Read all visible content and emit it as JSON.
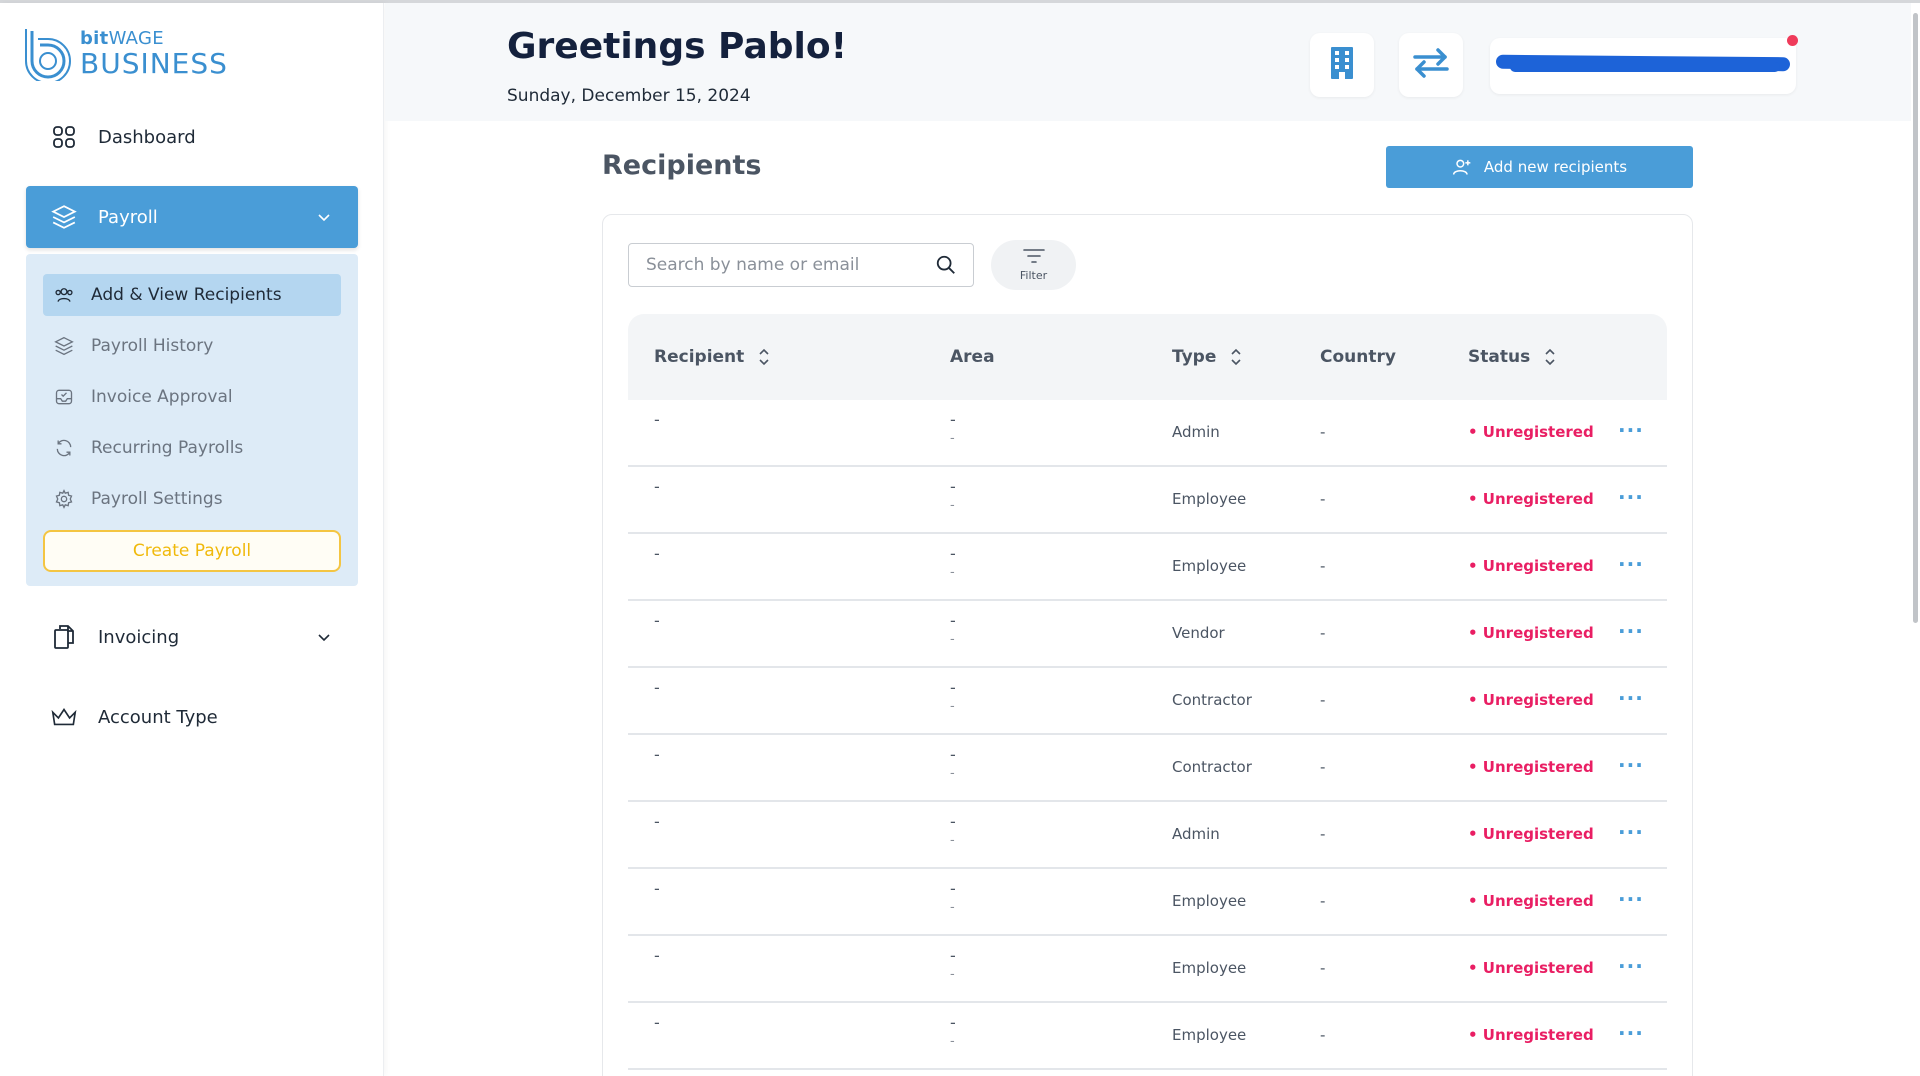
{
  "brand": {
    "small_prefix": "bit",
    "small_suffix": "WAGE",
    "big": "BUSINESS",
    "color": "#3a8fd0"
  },
  "sidebar": {
    "dashboard": "Dashboard",
    "payroll": "Payroll",
    "submenu": [
      {
        "label": "Add & View Recipients",
        "icon": "users-icon",
        "active": true
      },
      {
        "label": "Payroll History",
        "icon": "layers-icon"
      },
      {
        "label": "Invoice Approval",
        "icon": "inbox-check-icon"
      },
      {
        "label": "Recurring Payrolls",
        "icon": "refresh-icon"
      },
      {
        "label": "Payroll Settings",
        "icon": "gear-icon"
      }
    ],
    "create_payroll": "Create Payroll",
    "invoicing": "Invoicing",
    "account_type": "Account Type"
  },
  "header": {
    "greeting": "Greetings Pablo!",
    "date": "Sunday, December 15, 2024"
  },
  "page": {
    "title": "Recipients",
    "add_button": "Add new recipients",
    "search_placeholder": "Search by name or email",
    "filter_label": "Filter"
  },
  "table": {
    "columns": {
      "recipient": "Recipient",
      "area": "Area",
      "type": "Type",
      "country": "Country",
      "status": "Status"
    },
    "rows": [
      {
        "recipient": "-",
        "area": "-",
        "area_sub": "-",
        "type": "Admin",
        "country": "-",
        "status": "• Unregistered"
      },
      {
        "recipient": "-",
        "area": "-",
        "area_sub": "-",
        "type": "Employee",
        "country": "-",
        "status": "• Unregistered"
      },
      {
        "recipient": "-",
        "area": "-",
        "area_sub": "-",
        "type": "Employee",
        "country": "-",
        "status": "• Unregistered"
      },
      {
        "recipient": "-",
        "area": "-",
        "area_sub": "-",
        "type": "Vendor",
        "country": "-",
        "status": "• Unregistered"
      },
      {
        "recipient": "-",
        "area": "-",
        "area_sub": "-",
        "type": "Contractor",
        "country": "-",
        "status": "• Unregistered"
      },
      {
        "recipient": "-",
        "area": "-",
        "area_sub": "-",
        "type": "Contractor",
        "country": "-",
        "status": "• Unregistered"
      },
      {
        "recipient": "-",
        "area": "-",
        "area_sub": "-",
        "type": "Admin",
        "country": "-",
        "status": "• Unregistered"
      },
      {
        "recipient": "-",
        "area": "-",
        "area_sub": "-",
        "type": "Employee",
        "country": "-",
        "status": "• Unregistered"
      },
      {
        "recipient": "-",
        "area": "-",
        "area_sub": "-",
        "type": "Employee",
        "country": "-",
        "status": "• Unregistered"
      },
      {
        "recipient": "-",
        "area": "-",
        "area_sub": "-",
        "type": "Employee",
        "country": "-",
        "status": "• Unregistered"
      }
    ],
    "more_label": "···"
  },
  "colors": {
    "accent": "#4a9dd8",
    "status_unregistered": "#e91e63",
    "create_payroll": "#f0b90b"
  }
}
